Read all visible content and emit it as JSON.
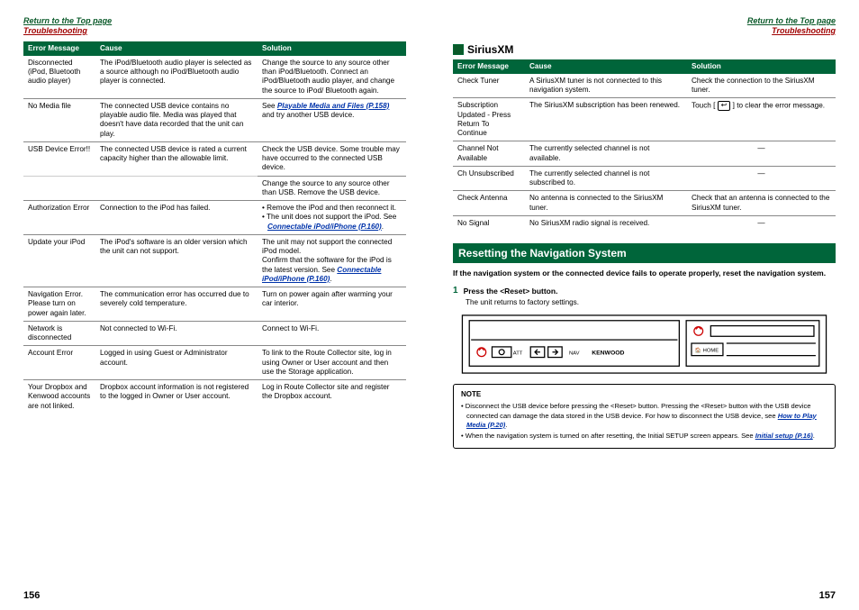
{
  "header": {
    "return": "Return to the Top page",
    "section": "Troubleshooting"
  },
  "left": {
    "cols": [
      "Error Message",
      "Cause",
      "Solution"
    ],
    "rows": [
      {
        "m": "Disconnected (iPod, Bluetooth audio player)",
        "c": "The iPod/Bluetooth audio player is selected as a source although no iPod/Bluetooth audio player is connected.",
        "s": "Change the source to any source other than iPod/Bluetooth. Connect an iPod/Bluetooth audio player, and change the source to iPod/ Bluetooth again."
      },
      {
        "m": "No Media file",
        "c": "The connected USB device contains no playable audio file. Media was played that doesn't have data recorded that the unit can play.",
        "s_pre": "See ",
        "s_link": "Playable Media and Files (P.158)",
        "s_post": " and try another USB device."
      },
      {
        "m": "USB Device Error!!",
        "c": "The connected USB device is rated a current capacity higher than the allowable limit.",
        "s": "Check the USB device. Some trouble may have occurred to the connected USB device."
      },
      {
        "m": "",
        "c": "",
        "s": "Change the source to any source other than USB. Remove the USB device."
      },
      {
        "m": "Authorization Error",
        "c": "Connection to the iPod has failed.",
        "s_items": [
          {
            "txt": "Remove the iPod and then reconnect it."
          },
          {
            "txt_pre": "The unit does not support the iPod. See ",
            "link": "Connectable iPod/iPhone (P.160)",
            "txt_post": "."
          }
        ]
      },
      {
        "m": "Update your iPod",
        "c": "The iPod's software is an older version which the unit can not support.",
        "s_lines": [
          "The unit may not support the connected iPod model.",
          {
            "txt_pre": "Confirm that the software for the iPod is the latest version. See ",
            "link": "Connectable iPod/iPhone (P.160)",
            "txt_post": "."
          }
        ]
      },
      {
        "m": "Navigation Error. Please turn on power again later.",
        "c": "The communication error has occurred due to severely cold temperature.",
        "s": "Turn on power again after warming your car interior."
      },
      {
        "m": "Network is disconnected",
        "c": "Not connected to Wi-Fi.",
        "s": "Connect to Wi-Fi."
      },
      {
        "m": "Account Error",
        "c": "Logged in using Guest or Administrator account.",
        "s": "To link to the Route Collector site, log in using Owner or User account and then use the Storage application."
      },
      {
        "m": "Your Dropbox and Kenwood accounts are not linked.",
        "c": "Dropbox account information is not registered to the logged in Owner or User account.",
        "s": "Log in Route Collector site and register the Dropbox account."
      }
    ],
    "pageno": "156"
  },
  "right": {
    "sirius_title": "SiriusXM",
    "cols": [
      "Error Message",
      "Cause",
      "Solution"
    ],
    "rows": [
      {
        "m": "Check Tuner",
        "c": "A SiriusXM tuner is not connected to this navigation system.",
        "s": "Check the connection to the SiriusXM tuner."
      },
      {
        "m": "Subscription Updated - Press Return To Continue",
        "c": "The SiriusXM subscription has been renewed.",
        "s_pre": "Touch [ ",
        "s_icon": "↩",
        "s_post": " ] to clear the error message."
      },
      {
        "m": "Channel Not Available",
        "c": "The currently selected channel is not available.",
        "s": "—",
        "ctr": true
      },
      {
        "m": "Ch Unsubscribed",
        "c": "The currently selected channel is not subscribed to.",
        "s": "—",
        "ctr": true
      },
      {
        "m": "Check Antenna",
        "c": "No antenna is connected to the SiriusXM tuner.",
        "s": "Check that an antenna is connected to the SiriusXM tuner."
      },
      {
        "m": "No Signal",
        "c": "No SiriusXM radio signal is received.",
        "s": "—",
        "ctr": true
      }
    ],
    "reset": {
      "bar": "Resetting the Navigation System",
      "intro": "If the navigation system or the connected device fails to operate properly, reset the navigation system.",
      "step_no": "1",
      "step_title": "Press the <Reset> button.",
      "step_body": "The unit returns to factory settings.",
      "note_title": "NOTE",
      "note1_pre": "Disconnect the USB device before pressing the <Reset> button. Pressing the <Reset> button with the USB device connected can damage the data stored in the USB device. For how to disconnect the USB device, see ",
      "note1_link": "How to Play Media (P.20)",
      "note1_post": ".",
      "note2_pre": "When the navigation system is turned on after resetting, the Initial SETUP screen appears. See ",
      "note2_link": "Initial setup (P.16)",
      "note2_post": "."
    },
    "pageno": "157"
  }
}
